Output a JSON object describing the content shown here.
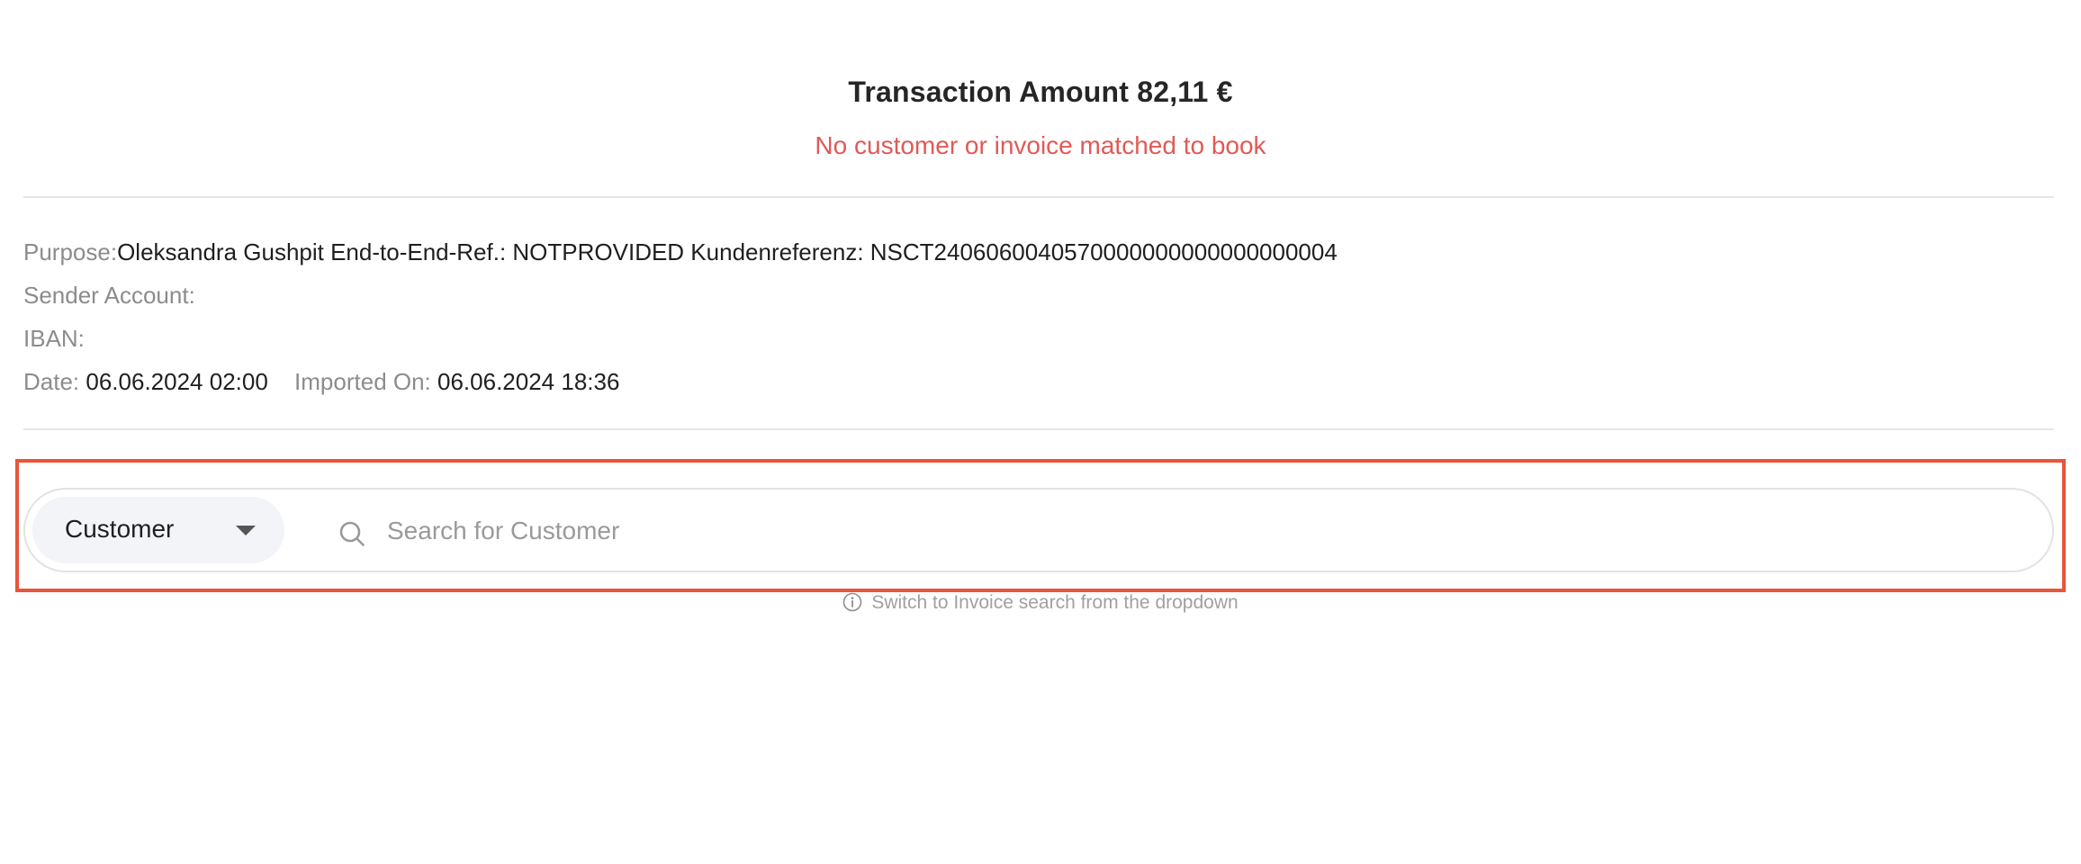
{
  "header": {
    "amount": "Transaction Amount 82,11 €",
    "status": "No customer or invoice matched to book"
  },
  "details": {
    "purpose_label": "Purpose:",
    "purpose_value": "Oleksandra Gushpit End-to-End-Ref.: NOTPROVIDED Kundenreferenz: NSCT2406060040570000000000000000004",
    "sender_label": "Sender Account:",
    "sender_value": "",
    "iban_label": "IBAN:",
    "iban_value": "",
    "date_label": "Date:",
    "date_value": "06.06.2024 02:00",
    "imported_label": "Imported On:",
    "imported_value": "06.06.2024 18:36"
  },
  "search": {
    "type_selected": "Customer",
    "placeholder": "Search for Customer",
    "value": "",
    "hint": "Switch to Invoice search from the dropdown"
  },
  "colors": {
    "status_red": "#e05a56",
    "highlight_border": "#e8553a",
    "dropdown_bg": "#f3f4f8"
  },
  "icons": {
    "dropdown": "chevron-down-icon",
    "search": "search-icon",
    "hint": "info-icon"
  }
}
